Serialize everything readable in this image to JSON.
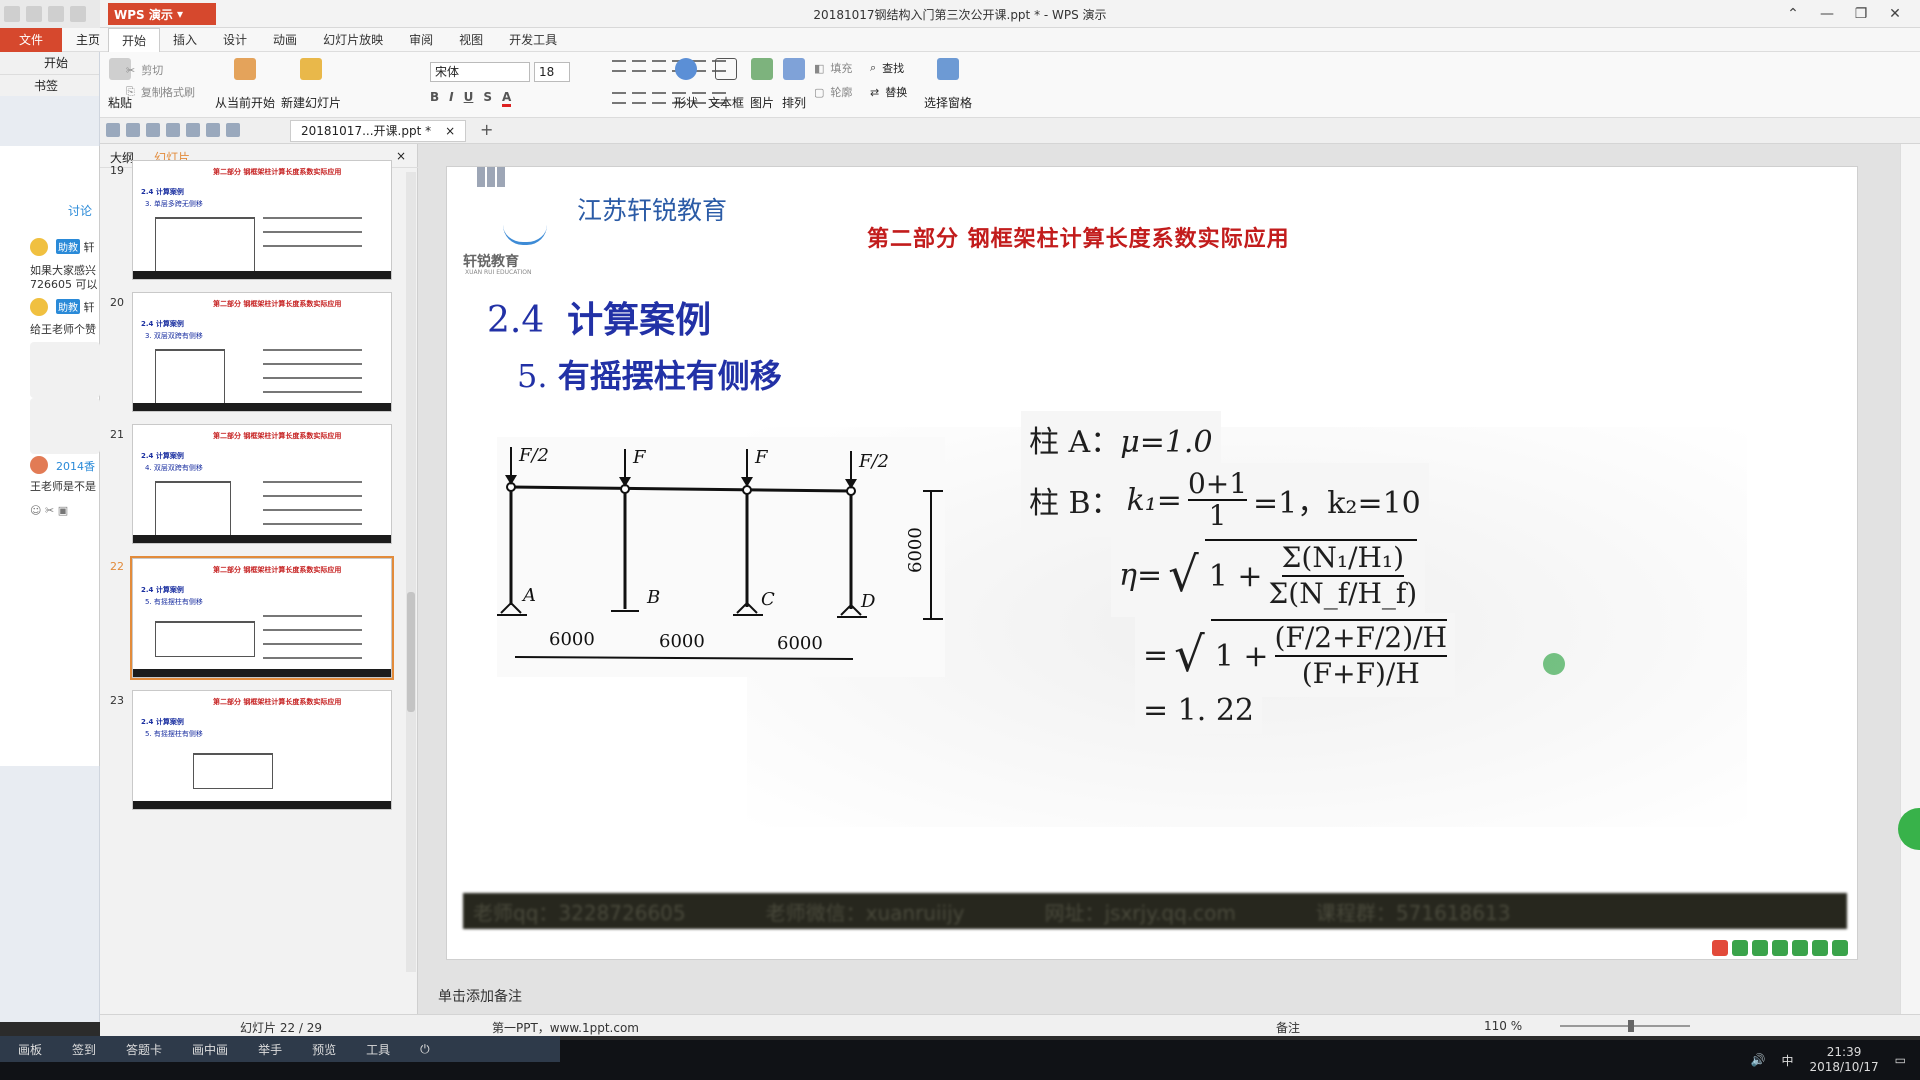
{
  "window": {
    "title": "20181017钢结构入门第三次公开课.ppt * - WPS 演示",
    "app_button": "WPS 演示"
  },
  "menubar": {
    "file": "文件",
    "home": "主页",
    "tabs": [
      "开始",
      "插入",
      "设计",
      "动画",
      "幻灯片放映",
      "审阅",
      "视图",
      "开发工具"
    ]
  },
  "ribbon": {
    "paste": "粘贴",
    "cut": "剪切",
    "copy": "复制",
    "format_painter": "格式刷",
    "from_current": "从当前开始",
    "new_slide": "新建幻灯片",
    "font_name": "宋体",
    "font_size": "18",
    "shapes": "形状",
    "textbox": "文本框",
    "picture": "图片",
    "arrange": "排列",
    "fill": "填充",
    "outline": "轮廓",
    "find": "查找",
    "replace": "替换",
    "select_pane": "选择窗格"
  },
  "doc_tab": {
    "label": "20181017...开课.ppt *",
    "close": "×"
  },
  "outer_left": {
    "start": "开始",
    "bookmark": "书签",
    "discussion": "讨论",
    "messages": [
      {
        "role": "助教",
        "name": "轩",
        "text": "如果大家感兴"
      },
      {
        "role": "",
        "name": "",
        "text": "726605 可以"
      },
      {
        "role": "助教",
        "name": "轩",
        "text": "给王老师个赞"
      },
      {
        "role": "",
        "name": "2014香",
        "text": "王老师是不是"
      }
    ]
  },
  "slide_panel": {
    "tab_outline": "大纲",
    "tab_slides": "幻灯片",
    "thumbnails": [
      {
        "num": "19",
        "title": "第二部分 钢框架柱计算长度系数实际应用",
        "h1": "2.4 计算案例",
        "h2": "3. 单层多跨无侧移"
      },
      {
        "num": "20",
        "title": "第二部分 钢框架柱计算长度系数实际应用",
        "h1": "2.4 计算案例",
        "h2": "3. 双层双跨有侧移"
      },
      {
        "num": "21",
        "title": "第二部分 钢框架柱计算长度系数实际应用",
        "h1": "2.4 计算案例",
        "h2": "4. 双层双跨有侧移"
      },
      {
        "num": "22",
        "title": "第二部分 钢框架柱计算长度系数实际应用",
        "h1": "2.4 计算案例",
        "h2": "5. 有摇摆柱有侧移"
      },
      {
        "num": "23",
        "title": "第二部分 钢框架柱计算长度系数实际应用",
        "h1": "2.4 计算案例",
        "h2": "5. 有摇摆柱有侧移"
      }
    ]
  },
  "slide": {
    "org_name": "江苏轩锐教育",
    "logo_text": "轩锐教育",
    "logo_sub": "XUAN RUI EDUCATION",
    "part_title": "第二部分 钢框架柱计算长度系数实际应用",
    "section_num": "2.4",
    "section_title": "计算案例",
    "sub_num": "5.",
    "sub_title": "有摇摆柱有侧移",
    "diagram": {
      "loads": [
        "F/2",
        "F",
        "F",
        "F/2"
      ],
      "supports": [
        "A",
        "B",
        "C",
        "D"
      ],
      "spans": [
        "6000",
        "6000",
        "6000"
      ],
      "height": "6000"
    },
    "formulas": {
      "col_a_prefix": "柱 A：",
      "col_a_expr": "μ=1.0",
      "col_b_prefix": "柱 B：",
      "col_b_k1": "k₁=",
      "col_b_num": "0+1",
      "col_b_den": "1",
      "col_b_tail": "=1，k₂=10",
      "eta_lhs": "η=",
      "eta_num": "Σ(N₁/H₁)",
      "eta_den": "Σ(N_f/H_f)",
      "eta2_num": "(F/2+F/2)/H",
      "eta2_den": "(F+F)/H",
      "result": "= 1. 22"
    },
    "footer_items": [
      "老师qq：3228726605",
      "老师微信：xuanruiijy",
      "网址：jsxrjy.qq.com",
      "课程群：571618613"
    ]
  },
  "notes_placeholder": "单击添加备注",
  "statusbar": {
    "slide_count": "幻灯片 22 / 29",
    "theme": "第一PPT，www.1ppt.com",
    "notes": "备注",
    "zoom": "110 %"
  },
  "classroom_toolbar": [
    "画板",
    "签到",
    "答题卡",
    "画中画",
    "举手",
    "预览",
    "工具"
  ],
  "taskbar": {
    "ime": "中",
    "time": "21:39",
    "date": "2018/10/17"
  },
  "colors": {
    "accent": "#d6482d",
    "slide_title_red": "#c21c1c",
    "slide_blue": "#2231a6",
    "org_blue": "#2b5ba6"
  }
}
